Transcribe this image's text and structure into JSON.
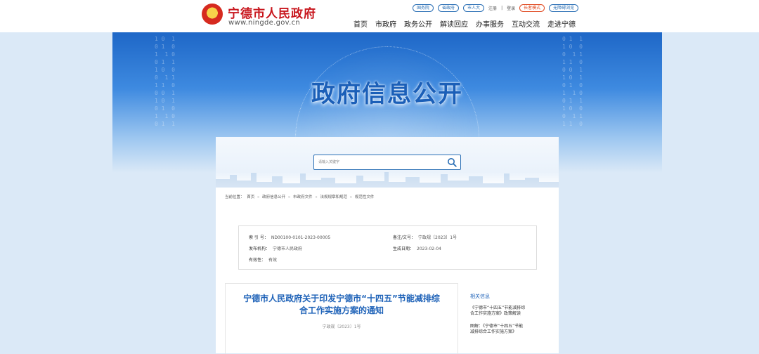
{
  "header": {
    "site_name": "宁德市人民政府",
    "site_url": "www.ningde.gov.cn",
    "top_links": [
      {
        "label": "国务院",
        "style": "pill"
      },
      {
        "label": "省政府",
        "style": "pill"
      },
      {
        "label": "市人大",
        "style": "pill"
      },
      {
        "label": "注册",
        "style": "plain"
      },
      {
        "label": "|",
        "style": "plain"
      },
      {
        "label": "登录",
        "style": "plain"
      },
      {
        "label": "长者模式",
        "style": "pill-red"
      },
      {
        "label": "无障碍浏览",
        "style": "pill"
      }
    ],
    "nav": [
      "首页",
      "市政府",
      "政务公开",
      "解读回应",
      "办事服务",
      "互动交流",
      "走进宁德"
    ]
  },
  "banner": {
    "title": "政府信息公开"
  },
  "search": {
    "placeholder": "请输入关键字"
  },
  "breadcrumb": {
    "prefix": "当前位置：",
    "items": [
      "首页",
      "政府信息公开",
      "市政府文件",
      "法规规章和规范",
      "规范性文件"
    ],
    "separator": "»"
  },
  "info": {
    "index_label": "索 引 号：",
    "index_value": "ND00100-0101-2023-00005",
    "doc_label": "备注/文号：",
    "doc_value": "宁政规〔2023〕1号",
    "org_label": "发布机构：",
    "org_value": "宁德市人民政府",
    "date_label": "生成日期：",
    "date_value": "2023-02-04",
    "validity_label": "有效性：",
    "validity_value": "有效"
  },
  "article": {
    "title_line1": "宁德市人民政府关于印发宁德市“十四五”节能减排综",
    "title_line2": "合工作实施方案的通知",
    "doc_no": "宁政规〔2023〕1号"
  },
  "related": {
    "heading": "相关信息",
    "items": [
      {
        "line1": "《宁德市“十四五”节能减排综",
        "line2": "合工作实施方案》政策解读"
      },
      {
        "line1": "图解：《宁德市“十四五”节能",
        "line2": "减排综合工作实施方案》"
      }
    ]
  },
  "colors": {
    "brand_red": "#c8161d",
    "accent_blue": "#1e62b8",
    "page_bg": "#dbe9f7"
  }
}
